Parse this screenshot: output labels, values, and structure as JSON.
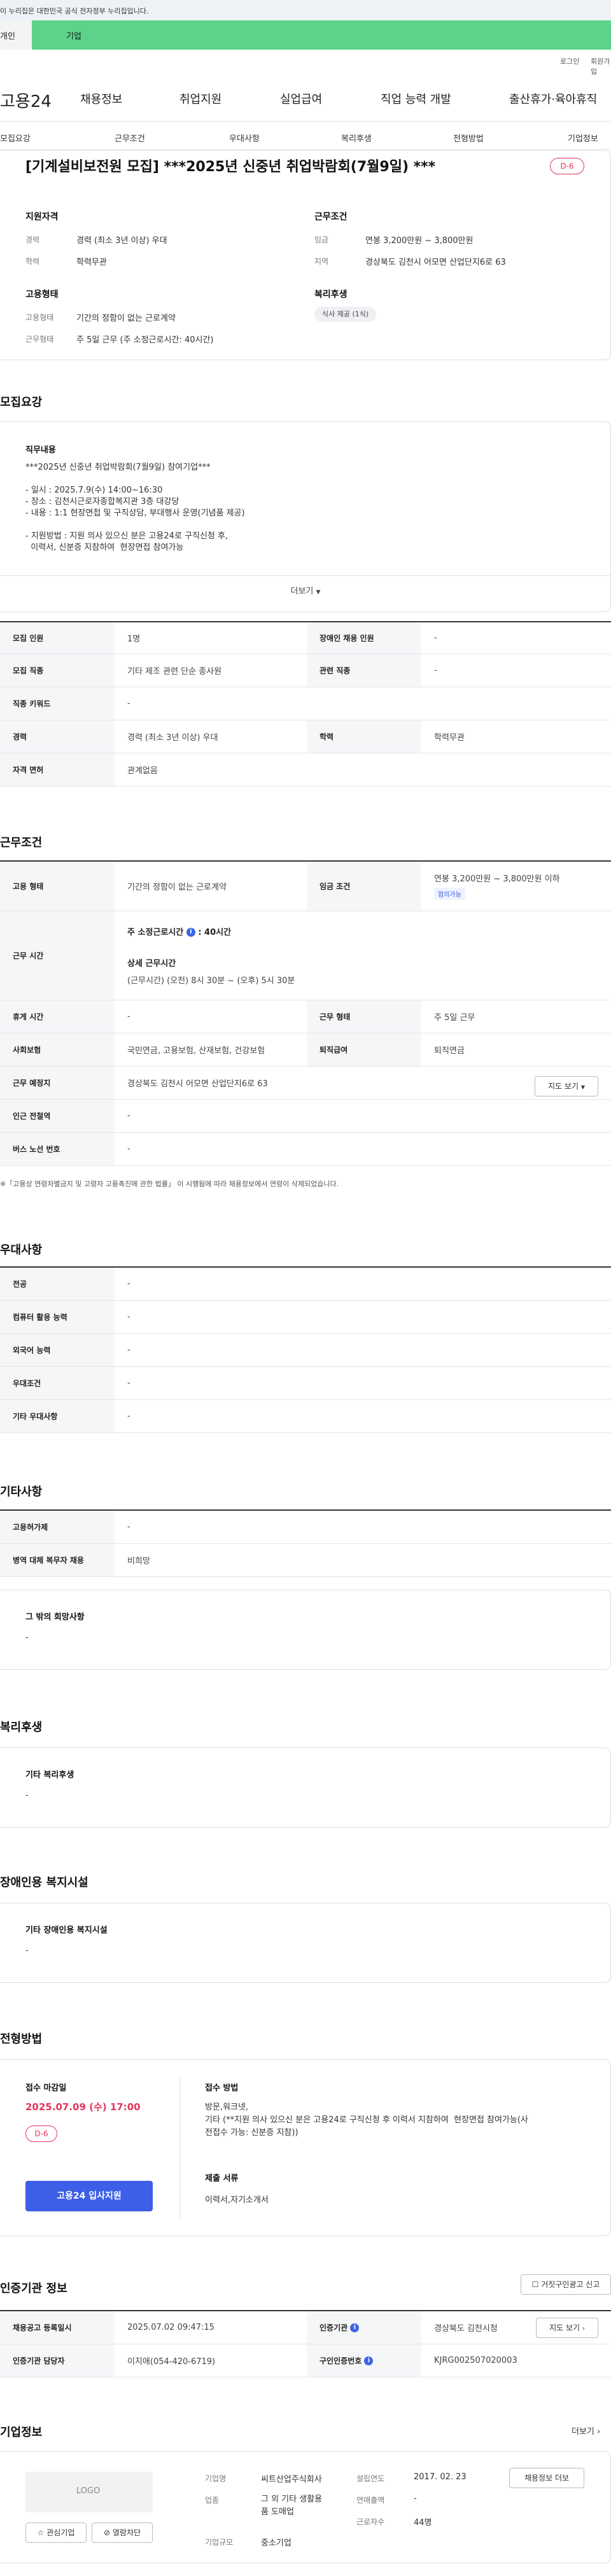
{
  "gov_notice": "이 누리집은 대한민국 공식 전자정부 누리집입니다.",
  "service_tabs": {
    "person": "개인",
    "business": "기업"
  },
  "utility": {
    "login": "로그인",
    "join": "회원가입"
  },
  "logo_text": "고용24",
  "gnb": [
    "채용정보",
    "취업지원",
    "실업급여",
    "직업 능력 개발",
    "출산휴가·육아휴직"
  ],
  "sub_nav": [
    "모집요강",
    "근무조건",
    "우대사항",
    "복리후생",
    "전형방법",
    "기업정보"
  ],
  "job": {
    "title": "[기계설비보전원 모집] ***2025년 신중년 취업박람회(7월9일) ***",
    "dday": "D-6"
  },
  "summary": {
    "qual_heading": "지원자격",
    "career_label": "경력",
    "career_value": "경력 (최소 3년 이상) 우대",
    "edu_label": "학력",
    "edu_value": "학력무관",
    "cond_heading": "근무조건",
    "wage_label": "임금",
    "wage_value": "연봉 3,200만원 ~ 3,800만원",
    "region_label": "지역",
    "region_value": "경상북도 김천시 어모면 산업단지6로 63",
    "emp_heading": "고용형태",
    "emp_type_label": "고용형태",
    "emp_type_value": "기간의 정함이 없는 근로계약",
    "work_type_label": "근무형태",
    "work_type_value": "주 5일 근무 (주 소정근로시간: 40시간)",
    "welfare_heading": "복리후생",
    "welfare_chip": "식사 제공 (1식)"
  },
  "recruit": {
    "section_title": "모집요강",
    "duty_heading": "직무내용",
    "duty_text": "***2025년 신중년 취업박람회(7월9일) 참여기업***\n\n- 일시 : 2025.7.9(수) 14:00~16:30\n- 장소 : 김천시근로자종합복지관 3층 대강당\n- 내용 : 1:1 현장면접 및 구직상담, 부대행사 운영(기념품 제공)\n\n- 지원방법 : 지원 의사 있으신 분은 고용24로 구직신청 후,\n  이력서, 신분증 지참하여  현장면접 참여가능",
    "more_label": "더보기",
    "rows": [
      {
        "k1": "모집 인원",
        "v1": "1명",
        "k2": "장애인 채용 인원",
        "v2": "-"
      },
      {
        "k1": "모집 직종",
        "v1": "기타 제조 관련 단순 종사원",
        "k2": "관련 직종",
        "v2": "-"
      },
      {
        "k1": "직종 키워드",
        "v1": "-"
      },
      {
        "k1": "경력",
        "v1": "경력 (최소 3년 이상) 우대",
        "k2": "학력",
        "v2": "학력무관"
      },
      {
        "k1": "자격 면허",
        "v1": "관계없음"
      }
    ]
  },
  "work": {
    "section_title": "근무조건",
    "emp_label": "고용 형태",
    "emp_value": "기간의 정함이 없는 근로계약",
    "wage_label": "임금 조건",
    "wage_value": "연봉 3,200만원 ~ 3,800만원 이하",
    "wage_tag": "협의가능",
    "hours_label": "근무 시간",
    "hours_week": "주 소정근로시간",
    "hours_value": ": 40시간",
    "hours_detail_label": "상세 근무시간",
    "hours_detail": "(근무시간) (오전) 8시 30분 ~ (오후) 5시 30분",
    "rest_label": "휴게 시간",
    "rest_value": "-",
    "shape_label": "근무 형태",
    "shape_value": "주 5일 근무",
    "ins_label": "사회보험",
    "ins_value": "국민연금, 고용보험, 산재보험, 건강보험",
    "retire_label": "퇴직급여",
    "retire_value": "퇴직연금",
    "place_label": "근무 예정지",
    "place_value": "경상북도 김천시 어모면 산업단지6로 63",
    "map_label": "지도 보기",
    "subway_label": "인근 전철역",
    "subway_value": "-",
    "bus_label": "버스 노선 번호",
    "bus_value": "-",
    "note": "※「고용상 연령차별금지 및 고령자 고용촉진에 관한 법률」 이 시행됨에 따라 채용정보에서 연령이 삭제되었습니다."
  },
  "pref": {
    "section_title": "우대사항",
    "rows": [
      {
        "k": "전공",
        "v": "-"
      },
      {
        "k": "컴퓨터 활용 능력",
        "v": "-"
      },
      {
        "k": "외국어 능력",
        "v": "-"
      },
      {
        "k": "우대조건",
        "v": "-"
      },
      {
        "k": "기타 우대사항",
        "v": "-"
      }
    ]
  },
  "etc": {
    "section_title": "기타사항",
    "rows": [
      {
        "k": "고용허가제",
        "v": "-"
      },
      {
        "k": "병역 대체 복무자 채용",
        "v": "비희망"
      }
    ],
    "other_heading": "그 밖의 희망사항",
    "other_value": "-"
  },
  "welfare": {
    "section_title": "복리후생",
    "heading": "기타 복리후생",
    "value": "-"
  },
  "disabled": {
    "section_title": "장애인용 복지시설",
    "heading": "기타 장애인용 복지시설",
    "value": "-"
  },
  "screening": {
    "section_title": "전형방법",
    "deadline_label": "접수 마감일",
    "deadline_value": "2025.07.09 (수) 17:00",
    "dday": "D-6",
    "apply_btn": "고용24 입사지원",
    "method_heading": "접수 방법",
    "method_text": "방문,워크넷,\n기타 (**지원 의사 있으신 분은 고용24로 구직신청 후 이력서 지참하여  현장면접 참여가능(사\n전접수 가능: 신분증 지참))",
    "docs_heading": "제출 서류",
    "docs_value": "이력서,자기소개서"
  },
  "agency": {
    "section_title": "인증기관 정보",
    "report_btn": "거짓구인광고 신고",
    "reg_label": "채용공고 등록일시",
    "reg_value": "2025.07.02 09:47:15",
    "org_label": "인증기관",
    "org_value": "경상북도 김천시청",
    "map_label": "지도 보기",
    "staff_label": "인증기관 담당자",
    "staff_value": "이지애(054-420-6719)",
    "num_label": "구인인증번호",
    "num_value": "KJRG002507020003"
  },
  "company": {
    "section_title": "기업정보",
    "more_label": "더보기",
    "logo_text": "LOGO",
    "fav_btn": "관심기업",
    "block_btn": "열람차단",
    "name_label": "기업명",
    "name_value": "씨트산업주식회사",
    "year_label": "설립연도",
    "year_value": "2017. 02. 23",
    "jobs_btn": "채용정보 더보",
    "biz_label": "업종",
    "biz_value": "그 외 기타 생활용\n품 도매업",
    "sales_label": "연매출액",
    "sales_value": "-",
    "size_label": "기업규모",
    "size_value": "중소기업",
    "emp_label": "근로자수",
    "emp_value": "44명"
  }
}
